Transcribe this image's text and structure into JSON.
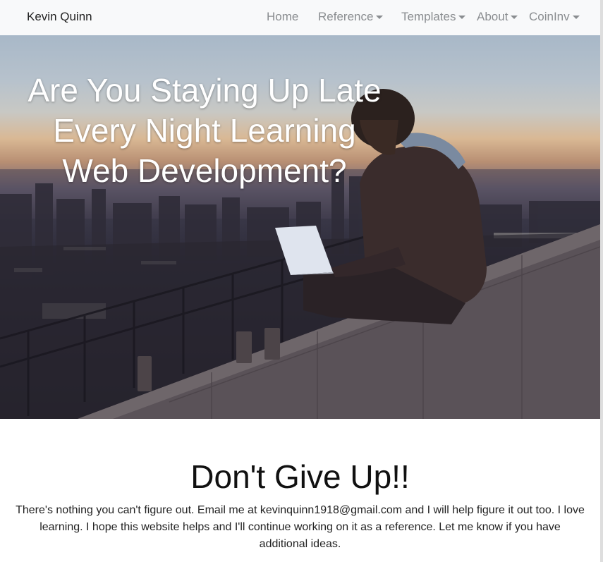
{
  "navbar": {
    "brand": "Kevin Quinn",
    "items": [
      {
        "label": "Home",
        "dropdown": false
      },
      {
        "label": "Reference",
        "dropdown": true
      },
      {
        "label": "Templates",
        "dropdown": true
      },
      {
        "label": "About",
        "dropdown": true
      },
      {
        "label": "CoinInv",
        "dropdown": true
      }
    ]
  },
  "hero": {
    "title_lines": [
      "Are You Staying Up Late",
      "Every Night Learning",
      "Web Development?"
    ],
    "image_description_icon": "person-laptop-city-dusk-image"
  },
  "main": {
    "heading": "Don't Give Up!!",
    "paragraph": "There's nothing you can't figure out. Email me at kevinquinn1918@gmail.com and I will help figure it out too. I love learning. I hope this website helps and I'll continue working on it as a reference. Let me know if you have additional ideas."
  },
  "colors": {
    "navbar_bg": "#f8f9fa",
    "nav_text": "#8a8d90",
    "brand_text": "#222222",
    "hero_text": "#ffffff"
  }
}
